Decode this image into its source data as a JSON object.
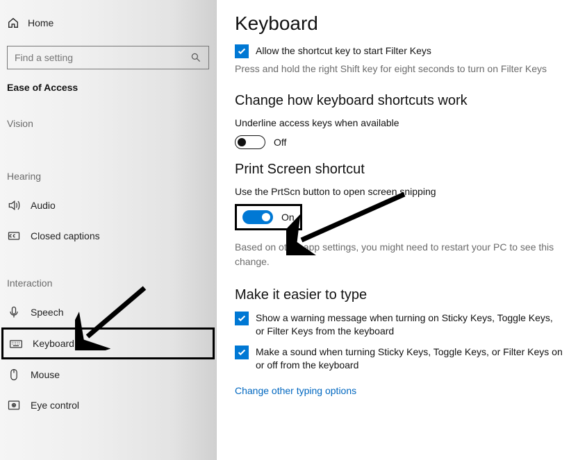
{
  "sidebar": {
    "home": "Home",
    "search_placeholder": "Find a setting",
    "category": "Ease of Access",
    "groups": [
      {
        "name": "Vision",
        "items": []
      },
      {
        "name": "Hearing",
        "items": [
          {
            "label": "Audio",
            "icon": "volume-icon"
          },
          {
            "label": "Closed captions",
            "icon": "caption-icon"
          }
        ]
      },
      {
        "name": "Interaction",
        "items": [
          {
            "label": "Speech",
            "icon": "microphone-icon"
          },
          {
            "label": "Keyboard",
            "icon": "keyboard-icon",
            "highlight": true
          },
          {
            "label": "Mouse",
            "icon": "mouse-icon"
          },
          {
            "label": "Eye control",
            "icon": "eye-control-icon"
          }
        ]
      }
    ]
  },
  "main": {
    "title": "Keyboard",
    "filter_keys": {
      "checkbox_label": "Allow the shortcut key to start Filter Keys",
      "hint": "Press and hold the right Shift key for eight seconds to turn on Filter Keys"
    },
    "shortcuts_section": {
      "title": "Change how keyboard shortcuts work",
      "subtext": "Underline access keys when available",
      "toggle_state": "Off"
    },
    "printscreen_section": {
      "title": "Print Screen shortcut",
      "subtext": "Use the PrtScn button to open screen snipping",
      "toggle_state": "On",
      "note": "Based on other app settings, you might need to restart your PC to see this change."
    },
    "easier_section": {
      "title": "Make it easier to type",
      "cb1": "Show a warning message when turning on Sticky Keys, Toggle Keys, or Filter Keys from the keyboard",
      "cb2": "Make a sound when turning Sticky Keys, Toggle Keys, or Filter Keys on or off from the keyboard",
      "link": "Change other typing options"
    }
  }
}
